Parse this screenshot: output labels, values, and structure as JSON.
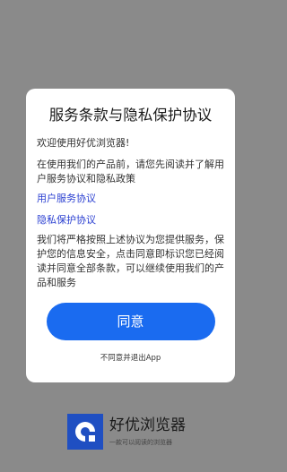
{
  "dialog": {
    "title": "服务条款与隐私保护协议",
    "welcome": "欢迎使用好优浏览器!",
    "intro": "在使用我们的产品前，请您先阅读并了解用户服务协议和隐私政策",
    "user_agreement_link": "用户服务协议",
    "privacy_link": "隐私保护协议",
    "promise": "我们将严格按照上述协议为您提供服务，保护您的信息安全，点击同意即标识您已经阅读并同意全部条款，可以继续使用我们的产品和服务",
    "agree_button": "同意",
    "decline_link": "不同意并退出App"
  },
  "brand": {
    "icon": "browser-logo-icon",
    "name": "好优浏览器",
    "slogan": "一款可以阅读的浏览器"
  },
  "colors": {
    "backdrop": "#8a8a8a",
    "accent": "#1a6bf0",
    "link": "#2a3fd1",
    "logo": "#1f4fc2"
  }
}
